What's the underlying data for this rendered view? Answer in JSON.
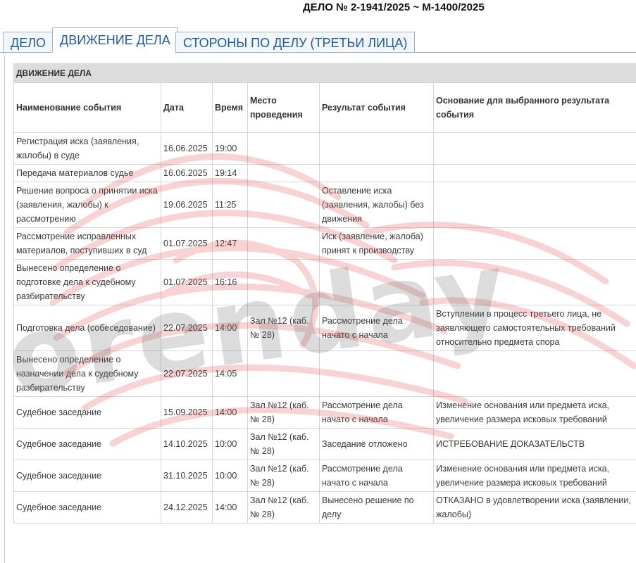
{
  "case_title": "ДЕЛО № 2-1941/2025 ~ М-1400/2025",
  "tabs": [
    {
      "label": "ДЕЛО",
      "active": false
    },
    {
      "label": "ДВИЖЕНИЕ ДЕЛА",
      "active": true
    },
    {
      "label": "СТОРОНЫ ПО ДЕЛУ (ТРЕТЬИ ЛИЦА)",
      "active": false
    }
  ],
  "section_title": "ДВИЖЕНИЕ ДЕЛА",
  "columns": [
    "Наименование события",
    "Дата",
    "Время",
    "Место проведения",
    "Результат события",
    "Основание для выбранного результата события"
  ],
  "rows": [
    {
      "name": "Регистрация иска (заявления, жалобы) в суде",
      "date": "16.06.2025",
      "time": "19:00",
      "place": "",
      "result": "",
      "basis": ""
    },
    {
      "name": "Передача материалов судье",
      "date": "16.06.2025",
      "time": "19:14",
      "place": "",
      "result": "",
      "basis": ""
    },
    {
      "name": "Решение вопроса о принятии иска (заявления, жалобы) к рассмотрению",
      "date": "19.06.2025",
      "time": "11:25",
      "place": "",
      "result": "Оставление иска (заявления, жалобы) без движения",
      "basis": ""
    },
    {
      "name": "Рассмотрение исправленных материалов, поступивших в суд",
      "date": "01.07.2025",
      "time": "12:47",
      "place": "",
      "result": "Иск (заявление, жалоба) принят к производству",
      "basis": ""
    },
    {
      "name": "Вынесено определение о подготовке дела к судебному разбирательству",
      "date": "01.07.2025",
      "time": "16:16",
      "place": "",
      "result": "",
      "basis": ""
    },
    {
      "name": "Подготовка дела (собеседование)",
      "date": "22.07.2025",
      "time": "14:00",
      "place": "Зал №12 (каб. № 28)",
      "result": "Рассмотрение дела начато с начала",
      "basis": "Вступлении в процесс третьего лица, не заявляющего самостоятельных требований относительно предмета спора"
    },
    {
      "name": "Вынесено определение о назначении дела к судебному разбирательству",
      "date": "22.07.2025",
      "time": "14:05",
      "place": "",
      "result": "",
      "basis": ""
    },
    {
      "name": "Судебное заседание",
      "date": "15.09.2025",
      "time": "14:00",
      "place": "Зал №12 (каб. № 28)",
      "result": "Рассмотрение дела начато с начала",
      "basis": "Изменение основания или предмета иска, увеличение размера исковых требований"
    },
    {
      "name": "Судебное заседание",
      "date": "14.10.2025",
      "time": "10:00",
      "place": "Зал №12 (каб. № 28)",
      "result": "Заседание отложено",
      "basis": "ИСТРЕБОВАНИЕ ДОКАЗАТЕЛЬСТВ"
    },
    {
      "name": "Судебное заседание",
      "date": "31.10.2025",
      "time": "10:00",
      "place": "Зал №12 (каб. № 28)",
      "result": "Рассмотрение дела начато с начала",
      "basis": "Изменение основания или предмета иска, увеличение размера исковых требований"
    },
    {
      "name": "Судебное заседание",
      "date": "24.12.2025",
      "time": "14:00",
      "place": "Зал №12 (каб. № 28)",
      "result": "Вынесено решение по делу",
      "basis": "ОТКАЗАНО в удовлетворении иска (заявлении, жалобы)"
    }
  ],
  "watermark": {
    "text": "orenday",
    "icon": "fingerprint-icon",
    "color_stripes": "#e23b3b",
    "color_text": "#555555"
  }
}
